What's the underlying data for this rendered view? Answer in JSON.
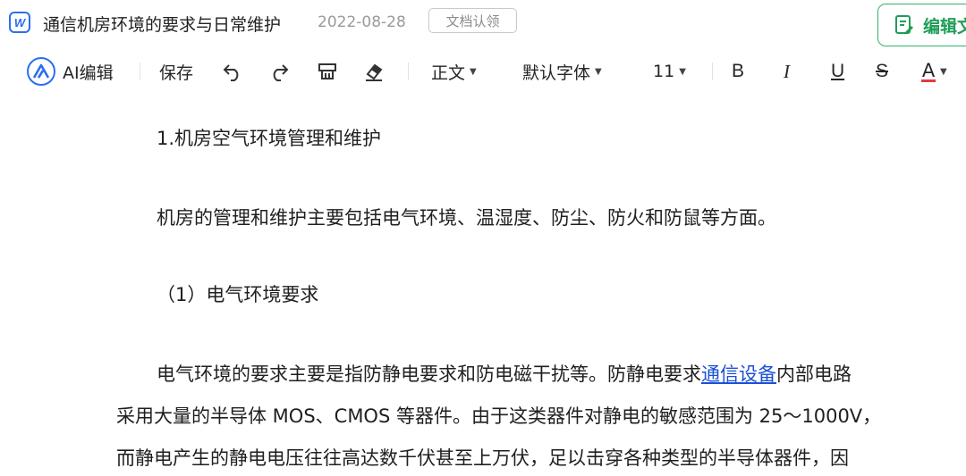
{
  "header": {
    "app_icon": "word-doc-icon",
    "app_icon_letter": "W",
    "title": "通信机房环境的要求与日常维护",
    "date": "2022-08-28",
    "claim_label": "文档认领",
    "edit_label": "编辑文"
  },
  "toolbar": {
    "ai_label": "AI编辑",
    "save_label": "保存",
    "style_label": "正文",
    "font_label": "默认字体",
    "size_label": "11",
    "bold_label": "B",
    "italic_label": "I",
    "underline_label": "U",
    "strike_label": "S",
    "fontcolor_label": "A"
  },
  "document": {
    "heading1": "1.机房空气环境管理和维护",
    "para1": "机房的管理和维护主要包括电气环境、温湿度、防尘、防火和防鼠等方面。",
    "heading2": "（1）电气环境要求",
    "para2_line1_a": "电气环境的要求主要是指防静电要求和防电磁干扰等。防静电要求",
    "para2_line1_link": "通信设备",
    "para2_line1_b": "内部电路",
    "para2_line2": "采用大量的半导体 MOS、CMOS 等器件。由于这类器件对静电的敏感范围为 25～1000V，",
    "para2_line3": "而静电产生的静电电压往往高达数千伏甚至上万伏，足以击穿各种类型的半导体器件，因"
  },
  "colors": {
    "accent_blue": "#2b6ef0",
    "edit_green": "#1e9e58",
    "link_blue": "#1a4fd6",
    "fontcolor_bar": "#e23b3b"
  }
}
